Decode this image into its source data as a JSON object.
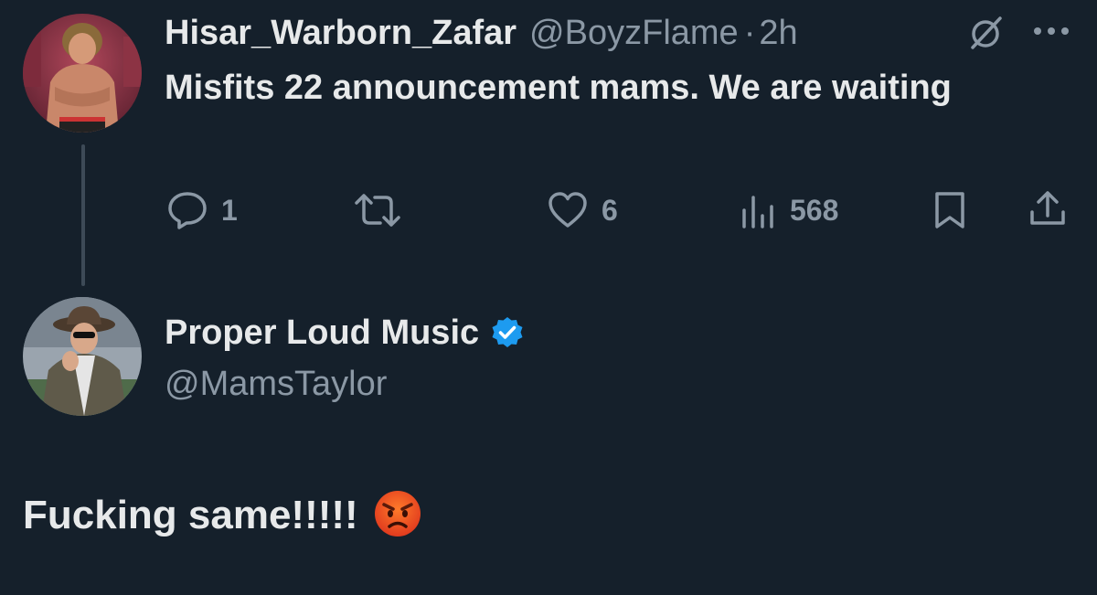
{
  "parent_tweet": {
    "display_name": "Hisar_Warborn_Zafar",
    "handle": "@BoyzFlame",
    "separator": "·",
    "timestamp": "2h",
    "text": "Misfits 22 announcement mams. We are waiting",
    "actions": {
      "reply_count": "1",
      "retweet_count": "",
      "like_count": "6",
      "view_count": "568"
    }
  },
  "reply_tweet": {
    "display_name": "Proper Loud Music",
    "verified": true,
    "handle": "@MamsTaylor",
    "text": "Fucking same!!!!!",
    "emoji": "😡"
  },
  "colors": {
    "background": "#15202b",
    "primary_text": "#e7e9ea",
    "secondary_text": "#8b98a5",
    "verified_blue": "#1d9bf0",
    "thread_line": "#3d4a57"
  },
  "icons": [
    "reply-icon",
    "retweet-icon",
    "like-icon",
    "views-icon",
    "bookmark-icon",
    "share-icon",
    "grok-icon",
    "more-icon",
    "verified-icon"
  ]
}
